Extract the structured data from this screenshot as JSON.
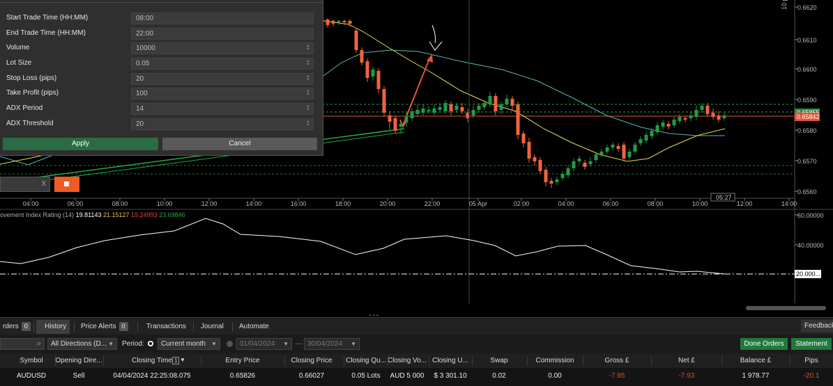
{
  "settings": {
    "rows": [
      {
        "label": "Start Trade Time (HH:MM)",
        "value": "08:00",
        "spinner": false
      },
      {
        "label": "End Trade Time (HH:MM)",
        "value": "22:00",
        "spinner": false
      },
      {
        "label": "Volume",
        "value": "10000",
        "spinner": true
      },
      {
        "label": "Lot Size",
        "value": "0.05",
        "spinner": true
      },
      {
        "label": "Stop Loss (pips)",
        "value": "20",
        "spinner": true
      },
      {
        "label": "Take Profit (pips)",
        "value": "100",
        "spinner": true
      },
      {
        "label": "ADX Period",
        "value": "14",
        "spinner": true
      },
      {
        "label": "ADX Threshold",
        "value": "20",
        "spinner": true
      }
    ],
    "apply_label": "Apply",
    "cancel_label": "Cancel",
    "mini_input_clear": "X"
  },
  "chart": {
    "price_labels": [
      "0.6620",
      "0.6610",
      "0.6600",
      "0.6590",
      "0.6580",
      "0.6570",
      "0.6560"
    ],
    "pip_label": "10 pips",
    "current_price_back": "0.65855",
    "current_price": "0.65842",
    "time_labels": [
      "04:00",
      "06:00",
      "08:00",
      "10:00",
      "12:00",
      "14:00",
      "16:00",
      "18:00",
      "20:00",
      "22:00",
      "05 Apr",
      "02:00",
      "04:00",
      "06:00",
      "08:00",
      "10:00",
      "12:00",
      "14:00"
    ],
    "countdown": "05:27",
    "colors": {
      "bull": "#1f9d46",
      "bear": "#f0643c",
      "ma_fast": "#e8e04a",
      "ma_slow": "#5ab8b8",
      "price_line": "#e8503a"
    }
  },
  "indicator": {
    "name": "ovement Index Rating (14)",
    "values": [
      "19.81143",
      "21.15127",
      "19.24993",
      "23.69846"
    ],
    "value_colors": [
      "#ffffff",
      "#e8c840",
      "#e84a3a",
      "#2aa84a"
    ],
    "scale_labels": [
      "60.00000",
      "40.00000"
    ],
    "threshold_label": "20.000..."
  },
  "tabs": {
    "items": [
      {
        "label": "rders",
        "badge": "0",
        "active": false
      },
      {
        "label": "History",
        "badge": "",
        "active": true
      },
      {
        "label": "Price Alerts",
        "badge": "0",
        "active": false
      },
      {
        "label": "Transactions",
        "badge": "",
        "active": false
      },
      {
        "label": "Journal",
        "badge": "",
        "active": false
      },
      {
        "label": "Automate",
        "badge": "",
        "active": false
      }
    ],
    "feedback_label": "Feedback"
  },
  "filters": {
    "direction": "All Directions (D...",
    "period_label": "Period:",
    "period_value": "Current month",
    "date_from": "01/04/2024",
    "date_dash": "—",
    "date_to": "30/04/2024",
    "done_orders_label": "Done Orders",
    "statement_label": "Statement"
  },
  "table": {
    "headers": [
      "Symbol",
      "Opening Dire...",
      "Closing Time",
      "Entry Price",
      "Closing Price",
      "Closing Qu...",
      "Closing Vo...",
      "Closing U...",
      "Swap",
      "Commission",
      "Gross £",
      "Net £",
      "Balance £",
      "Pips"
    ],
    "sort_indicator": "1",
    "rows": [
      [
        "AUDUSD",
        "Sell",
        "04/04/2024 22:25:08.075",
        "0.65826",
        "0.66027",
        "0.05 Lots",
        "AUD 5 000",
        "$ 3 301.10",
        "0.02",
        "0.00",
        "-7.95",
        "-7.93",
        "1 978.77",
        "-20.1"
      ]
    ]
  }
}
